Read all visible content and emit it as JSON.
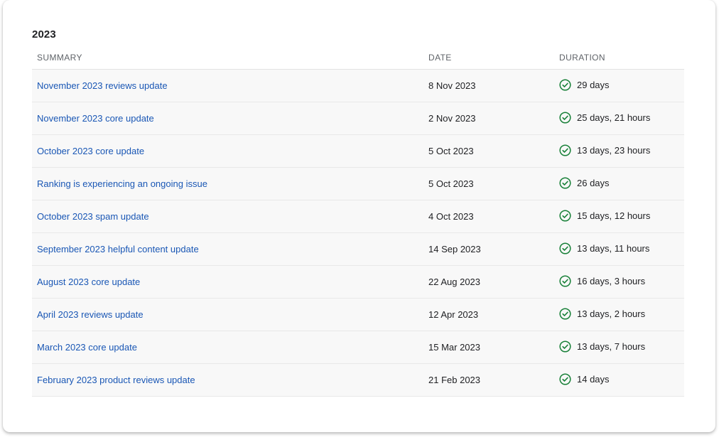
{
  "section": {
    "year": "2023"
  },
  "table": {
    "headers": {
      "summary": "SUMMARY",
      "date": "DATE",
      "duration": "DURATION"
    },
    "rows": [
      {
        "summary": "November 2023 reviews update",
        "date": "8 Nov 2023",
        "duration": "29 days",
        "status_icon": "check-circle-icon"
      },
      {
        "summary": "November 2023 core update",
        "date": "2 Nov 2023",
        "duration": "25 days, 21 hours",
        "status_icon": "check-circle-icon"
      },
      {
        "summary": "October 2023 core update",
        "date": "5 Oct 2023",
        "duration": "13 days, 23 hours",
        "status_icon": "check-circle-icon"
      },
      {
        "summary": "Ranking is experiencing an ongoing issue",
        "date": "5 Oct 2023",
        "duration": "26 days",
        "status_icon": "check-circle-icon"
      },
      {
        "summary": "October 2023 spam update",
        "date": "4 Oct 2023",
        "duration": "15 days, 12 hours",
        "status_icon": "check-circle-icon"
      },
      {
        "summary": "September 2023 helpful content update",
        "date": "14 Sep 2023",
        "duration": "13 days, 11 hours",
        "status_icon": "check-circle-icon"
      },
      {
        "summary": "August 2023 core update",
        "date": "22 Aug 2023",
        "duration": "16 days, 3 hours",
        "status_icon": "check-circle-icon"
      },
      {
        "summary": "April 2023 reviews update",
        "date": "12 Apr 2023",
        "duration": "13 days, 2 hours",
        "status_icon": "check-circle-icon"
      },
      {
        "summary": "March 2023 core update",
        "date": "15 Mar 2023",
        "duration": "13 days, 7 hours",
        "status_icon": "check-circle-icon"
      },
      {
        "summary": "February 2023 product reviews update",
        "date": "21 Feb 2023",
        "duration": "14 days",
        "status_icon": "check-circle-icon"
      }
    ]
  },
  "colors": {
    "link": "#1a57b5",
    "success": "#188038",
    "row_background": "#f8f8f8",
    "header_text": "#5f6368"
  }
}
